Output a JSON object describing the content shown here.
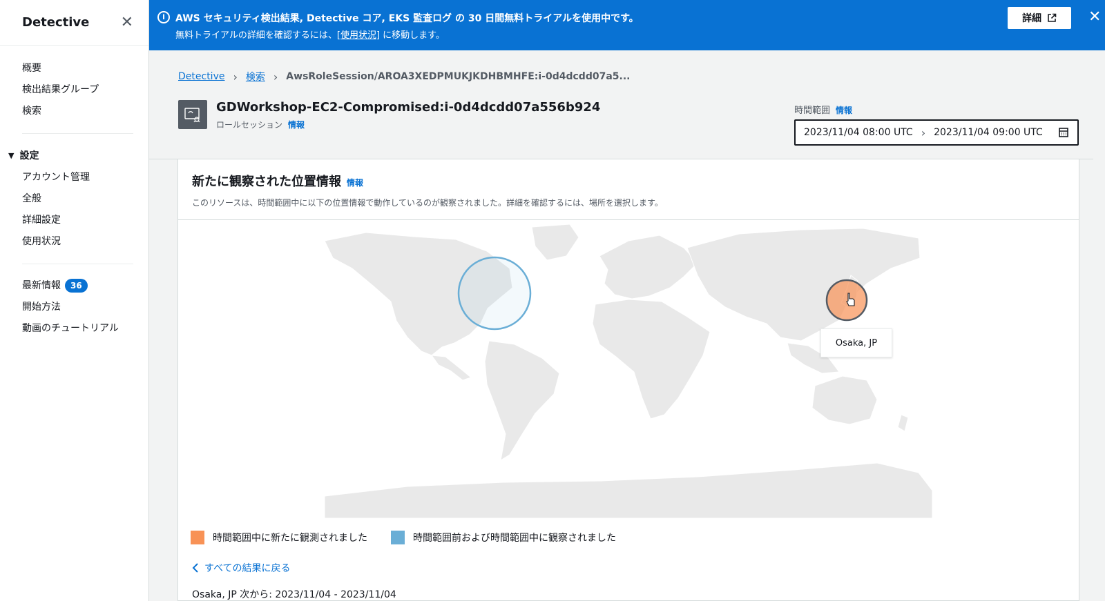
{
  "sidebar": {
    "title": "Detective",
    "items_top": [
      "概要",
      "検出結果グループ",
      "検索"
    ],
    "settings_title": "設定",
    "settings_items": [
      "アカウント管理",
      "全般",
      "詳細設定",
      "使用状況"
    ],
    "whats_new": "最新情報",
    "whats_new_count": "36",
    "getting_started": "開始方法",
    "video_tutorial": "動画のチュートリアル"
  },
  "banner": {
    "line1": "AWS セキュリティ検出結果, Detective コア, EKS 監査ログ の 30 日間無料トライアルを使用中です。",
    "line2_prefix": "無料トライアルの詳細を確認するには、",
    "line2_link": "[使用状況]",
    "line2_suffix": " に移動します。",
    "details_button": "詳細",
    "info_icon": "i"
  },
  "breadcrumb": {
    "root": "Detective",
    "search": "検索",
    "current": "AwsRoleSession/AROA3XEDPMUKJKDHBMHFE:i-0d4dcdd07a5..."
  },
  "resource": {
    "title": "GDWorkshop-EC2-Compromised:i-0d4dcdd07a556b924",
    "subtitle": "ロールセッション",
    "info": "情報"
  },
  "time_range": {
    "label": "時間範囲",
    "info": "情報",
    "start": "2023/11/04 08:00 UTC",
    "end": "2023/11/04 09:00 UTC"
  },
  "panel": {
    "title": "新たに観察された位置情報",
    "info": "情報",
    "description": "このリソースは、時間範囲中に以下の位置情報で動作しているのが観察されました。詳細を確認するには、場所を選択します。",
    "tooltip": "Osaka, JP",
    "legend_new": "時間範囲中に新たに観測されました",
    "legend_both": "時間範囲前および時間範囲中に観察されました",
    "back_link": "すべての結果に戻る",
    "location_text": "Osaka, JP 次から: 2023/11/04 - 2023/11/04"
  },
  "colors": {
    "accent": "#0972d3",
    "new_orange": "#f89256",
    "both_blue": "#6aaed6"
  }
}
